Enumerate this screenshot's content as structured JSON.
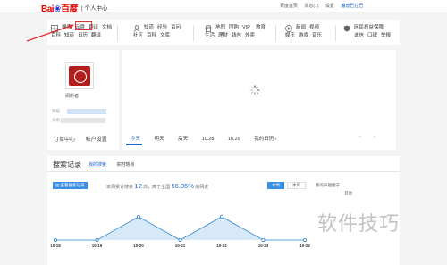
{
  "header": {
    "logo_bai": "Bai",
    "logo_paw": "❀",
    "logo_du": "百度",
    "subtitle": "| 个人中心",
    "links": [
      "百度首页",
      "消息(1)",
      "设置",
      "魔兽巴拉巴"
    ]
  },
  "nav": {
    "groups": [
      {
        "icon": "grid-icon",
        "row1": [
          "搜索",
          "云盘",
          "翻译",
          "文档"
        ],
        "row2": [
          "百科",
          "知道",
          "日历",
          "翻译"
        ]
      },
      {
        "icon": "person-icon",
        "row1": [
          "知道",
          "经验",
          "百问"
        ],
        "row2": [
          "社区",
          "百科",
          "文库"
        ]
      },
      {
        "icon": "shop-icon",
        "row1": [
          "地图",
          "团购",
          "VIP",
          "教育"
        ],
        "row2": [
          "生活",
          "理财",
          "钱包",
          "外卖"
        ]
      },
      {
        "icon": "play-icon",
        "row1": [
          "新闻",
          "视频"
        ],
        "row2": [
          "娱乐",
          "游戏",
          "音乐"
        ]
      },
      {
        "icon": "shield-icon",
        "row1": [
          "网民权益保障"
        ],
        "row2": [
          "诚信",
          "口碑",
          "举报"
        ]
      }
    ]
  },
  "profile": {
    "username": "阅新者",
    "label1": "等级",
    "label2": "头衔",
    "links": [
      "订单中心",
      "帐户设置"
    ]
  },
  "calendar": {
    "dates": [
      "今天",
      "明天",
      "后天",
      "10.28",
      "10.29",
      "我的日历 ›"
    ],
    "prev": "‹",
    "next": "›"
  },
  "search_records": {
    "title": "搜索记录",
    "tabs": [
      "我的搜索",
      "实时热点"
    ],
    "view_button": "查看搜索记录",
    "stat_prefix": "本周累计搜索",
    "stat_count": "12",
    "stat_mid": "次，高于全国",
    "stat_pct": "56.05%",
    "stat_suffix": "的网友",
    "week": "本周",
    "month": "本月",
    "interest": "我的兴趣圈子",
    "other": "其他"
  },
  "chart_data": {
    "type": "line",
    "categories": [
      "10-18",
      "10-19",
      "10-20",
      "10-21",
      "10-22",
      "10-23",
      "10-24"
    ],
    "values": [
      0,
      0,
      1,
      0,
      1,
      0,
      0
    ],
    "ylim": [
      0,
      1
    ],
    "color": "#2e86d4",
    "fill": "#d7e9f8"
  },
  "watermark": "软件技巧"
}
